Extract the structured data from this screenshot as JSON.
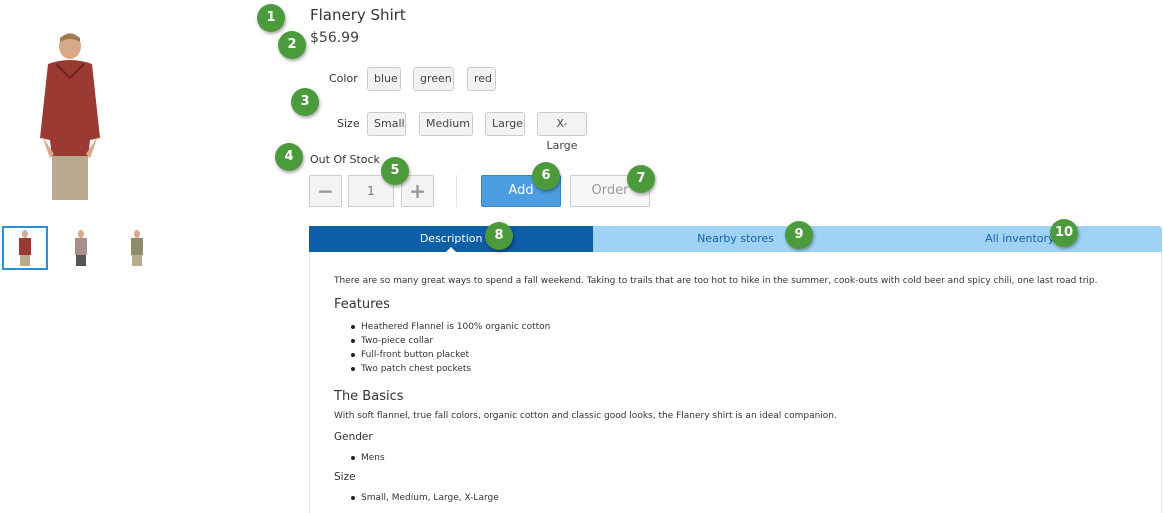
{
  "product": {
    "title": "Flanery Shirt",
    "price": "$56.99",
    "color_label": "Color",
    "colors": [
      "blue",
      "green",
      "red"
    ],
    "size_label": "Size",
    "sizes": [
      "Small",
      "Medium",
      "Large",
      "X-Large"
    ],
    "stock_status": "Out Of Stock",
    "quantity": "1",
    "minus_symbol": "−",
    "plus_symbol": "+",
    "add_label": "Add",
    "order_label": "Order"
  },
  "tabs": [
    {
      "label": "Description",
      "active": true
    },
    {
      "label": "Nearby stores",
      "active": false
    },
    {
      "label": "All inventory",
      "active": false
    }
  ],
  "description": {
    "intro": "There are so many great ways to spend a fall weekend. Taking to trails that are too hot to hike in the summer, cook-outs with cold beer and spicy chili, one last road trip.",
    "features_heading": "Features",
    "features": [
      "Heathered Flannel is 100% organic cotton",
      "Two-piece collar",
      "Full-front button placket",
      "Two patch chest pockets"
    ],
    "basics_heading": "The Basics",
    "basics_text": "With soft flannel, true fall colors, organic cotton and classic good looks, the Flanery shirt is an ideal companion.",
    "gender_heading": "Gender",
    "gender": [
      "Mens"
    ],
    "size_heading": "Size",
    "size_values": [
      "Small, Medium, Large, X-Large"
    ]
  },
  "badges": [
    "1",
    "2",
    "3",
    "4",
    "5",
    "6",
    "7",
    "8",
    "9",
    "10"
  ],
  "colors_theme": {
    "accent": "#4c9ddf",
    "tab_active": "#0c5ea6",
    "tab_inactive": "#9ed3f5",
    "badge": "#4b9b3d"
  }
}
